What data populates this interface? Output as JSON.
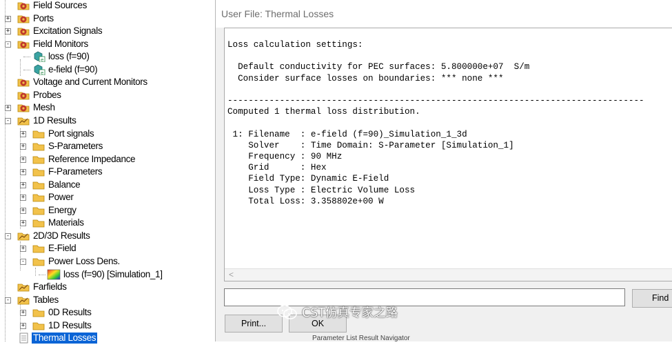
{
  "tree": {
    "items": [
      {
        "label": "Field Sources",
        "icon": "red-folder-icon"
      },
      {
        "label": "Ports",
        "icon": "red-folder-icon"
      },
      {
        "label": "Excitation Signals",
        "icon": "red-folder-icon"
      },
      {
        "label": "Field Monitors",
        "icon": "red-folder-icon"
      },
      {
        "label": "loss (f=90)",
        "icon": "monitor-cube-icon"
      },
      {
        "label": "e-field (f=90)",
        "icon": "monitor-cube-icon"
      },
      {
        "label": "Voltage and Current Monitors",
        "icon": "red-folder-icon"
      },
      {
        "label": "Probes",
        "icon": "red-folder-icon"
      },
      {
        "label": "Mesh",
        "icon": "red-folder-icon"
      },
      {
        "label": "1D Results",
        "icon": "results-folder-icon"
      },
      {
        "label": "Port signals",
        "icon": "yellow-folder-icon"
      },
      {
        "label": "S-Parameters",
        "icon": "yellow-folder-icon"
      },
      {
        "label": "Reference Impedance",
        "icon": "yellow-folder-icon"
      },
      {
        "label": "F-Parameters",
        "icon": "yellow-folder-icon"
      },
      {
        "label": "Balance",
        "icon": "yellow-folder-icon"
      },
      {
        "label": "Power",
        "icon": "yellow-folder-icon"
      },
      {
        "label": "Energy",
        "icon": "yellow-folder-icon"
      },
      {
        "label": "Materials",
        "icon": "yellow-folder-icon"
      },
      {
        "label": "2D/3D Results",
        "icon": "results-folder-icon"
      },
      {
        "label": "E-Field",
        "icon": "yellow-folder-icon"
      },
      {
        "label": "Power Loss Dens.",
        "icon": "yellow-folder-icon"
      },
      {
        "label": "loss (f=90) [Simulation_1]",
        "icon": "field-plot-icon"
      },
      {
        "label": "Farfields",
        "icon": "results-folder-icon"
      },
      {
        "label": "Tables",
        "icon": "results-folder-icon"
      },
      {
        "label": "0D Results",
        "icon": "yellow-folder-icon"
      },
      {
        "label": "1D Results",
        "icon": "yellow-folder-icon"
      },
      {
        "label": "Thermal Losses",
        "icon": "document-icon",
        "selected": true
      }
    ]
  },
  "dialog": {
    "title": "User File: Thermal Losses",
    "content": "Loss calculation settings:\n\n  Default conductivity for PEC surfaces: 5.800000e+07  S/m\n  Consider surface losses on boundaries: *** none ***\n\n--------------------------------------------------------------------------------\nComputed 1 thermal loss distribution.\n\n 1: Filename  : e-field (f=90)_Simulation_1_3d\n    Solver    : Time Domain: S-Parameter [Simulation_1]\n    Frequency : 90 MHz\n    Grid      : Hex\n    Field Type: Dynamic E-Field\n    Loss Type : Electric Volume Loss\n    Total Loss: 3.358802e+00 W",
    "scroll_left_glyph": "<",
    "find_value": "",
    "find_label": "Find",
    "print_label": "Print...",
    "ok_label": "OK"
  },
  "watermark": {
    "text": "CST仿真专家之路",
    "icon": "wechat-icon"
  },
  "background": {
    "bottom_tabs": "Parameter List    Result Navigator"
  },
  "colors": {
    "selection": "#0a64d6",
    "folder_yellow": "#f2c24b",
    "folder_red": "#c0392b",
    "dialog_bg": "#f0f0f0"
  }
}
